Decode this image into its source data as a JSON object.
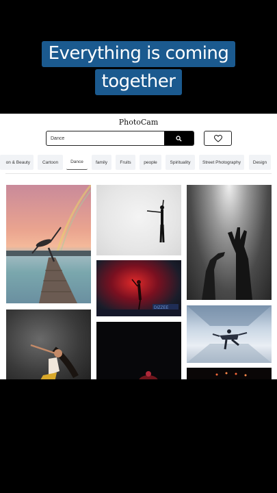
{
  "caption": {
    "line1": "Everything is coming",
    "line2": "together"
  },
  "site": {
    "brand": "PhotoCam"
  },
  "search": {
    "value": "Dance",
    "button_icon": "search-icon"
  },
  "favorites": {
    "icon": "heart-icon"
  },
  "categories": [
    {
      "label": "on & Beauty"
    },
    {
      "label": "Cartoon"
    },
    {
      "label": "Dance",
      "active": true
    },
    {
      "label": "family"
    },
    {
      "label": "Fruits"
    },
    {
      "label": "people"
    },
    {
      "label": "Spirituality"
    },
    {
      "label": "Street Photography"
    },
    {
      "label": "Design"
    }
  ],
  "photos": [
    {
      "subject": "dancer-on-pier-at-sunset-with-rainbow"
    },
    {
      "subject": "dancer-in-white-studio"
    },
    {
      "subject": "dancer-red-stage-light"
    },
    {
      "subject": "hands-reaching-into-light"
    },
    {
      "subject": "woman-dancing-dark-background"
    },
    {
      "subject": "performer-dark-stage"
    },
    {
      "subject": "man-jumping-in-white-tunnel"
    },
    {
      "subject": "concert-lights"
    }
  ],
  "photo_texts": {
    "stage_sign": "DIZZEE"
  }
}
